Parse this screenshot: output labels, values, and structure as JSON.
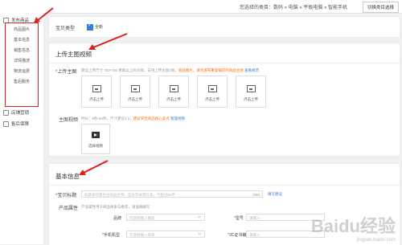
{
  "topbar": {
    "category_path": "您选择的类目：数码 » 电脑 » 平板电脑 » 智能手机",
    "recat_button": "切换类目选择"
  },
  "sidebar": {
    "release_label": "发布商品",
    "sub_items": [
      "商品图片",
      "基本信息",
      "销售信息",
      "详情描述",
      "物流运费",
      "售后服务"
    ],
    "other_items": [
      "店铺营销",
      "售后保障"
    ]
  },
  "product_type": {
    "label": "宝贝类型",
    "option": "全新"
  },
  "upload_section": {
    "title": "上传主图视频",
    "main_image_label": "上传主图",
    "main_image_hint": "建议上传尺寸 750*750 像素以上的大图，支持上传主图3张",
    "main_image_warn": "，商品图片，请勿发布重复铺货的商品主图",
    "main_image_link": "查看规范",
    "upload_box_label": "点击上传",
    "upload_count": 5,
    "video_label": "主图视频",
    "video_hint": "时长：9秒-60秒，尺寸建议1:1",
    "video_warn": "，建议突出商品核心卖点",
    "video_link": "管理视频",
    "video_box_label": "选择视频"
  },
  "basic_section": {
    "title": "基本信息",
    "title_field_label": "宝贝标题",
    "title_placeholder": "标题请尽量包含商品名称、型号等关键信息，不超过60字",
    "title_counter": "0/60",
    "title_link": "填写建议",
    "attr_label": "产品属性",
    "attr_hint": "产品属性用于商品搜索与推荐，请准确填写",
    "brand_label": "品牌",
    "brand_placeholder": "可直接输入搜索",
    "model_label": "型号",
    "model_placeholder": "请输入",
    "phone_model_label": "手机机型",
    "phone_model_placeholder": "可直接输入搜索",
    "cert_label": "3C证书编号",
    "cert_placeholder": "请输入"
  },
  "watermark": {
    "logo": "Baidu经验",
    "url": "jingyan.baidu.com"
  },
  "colors": {
    "accent": "#3a7bd5",
    "highlight": "#e02020",
    "warning": "#ff6a00"
  }
}
